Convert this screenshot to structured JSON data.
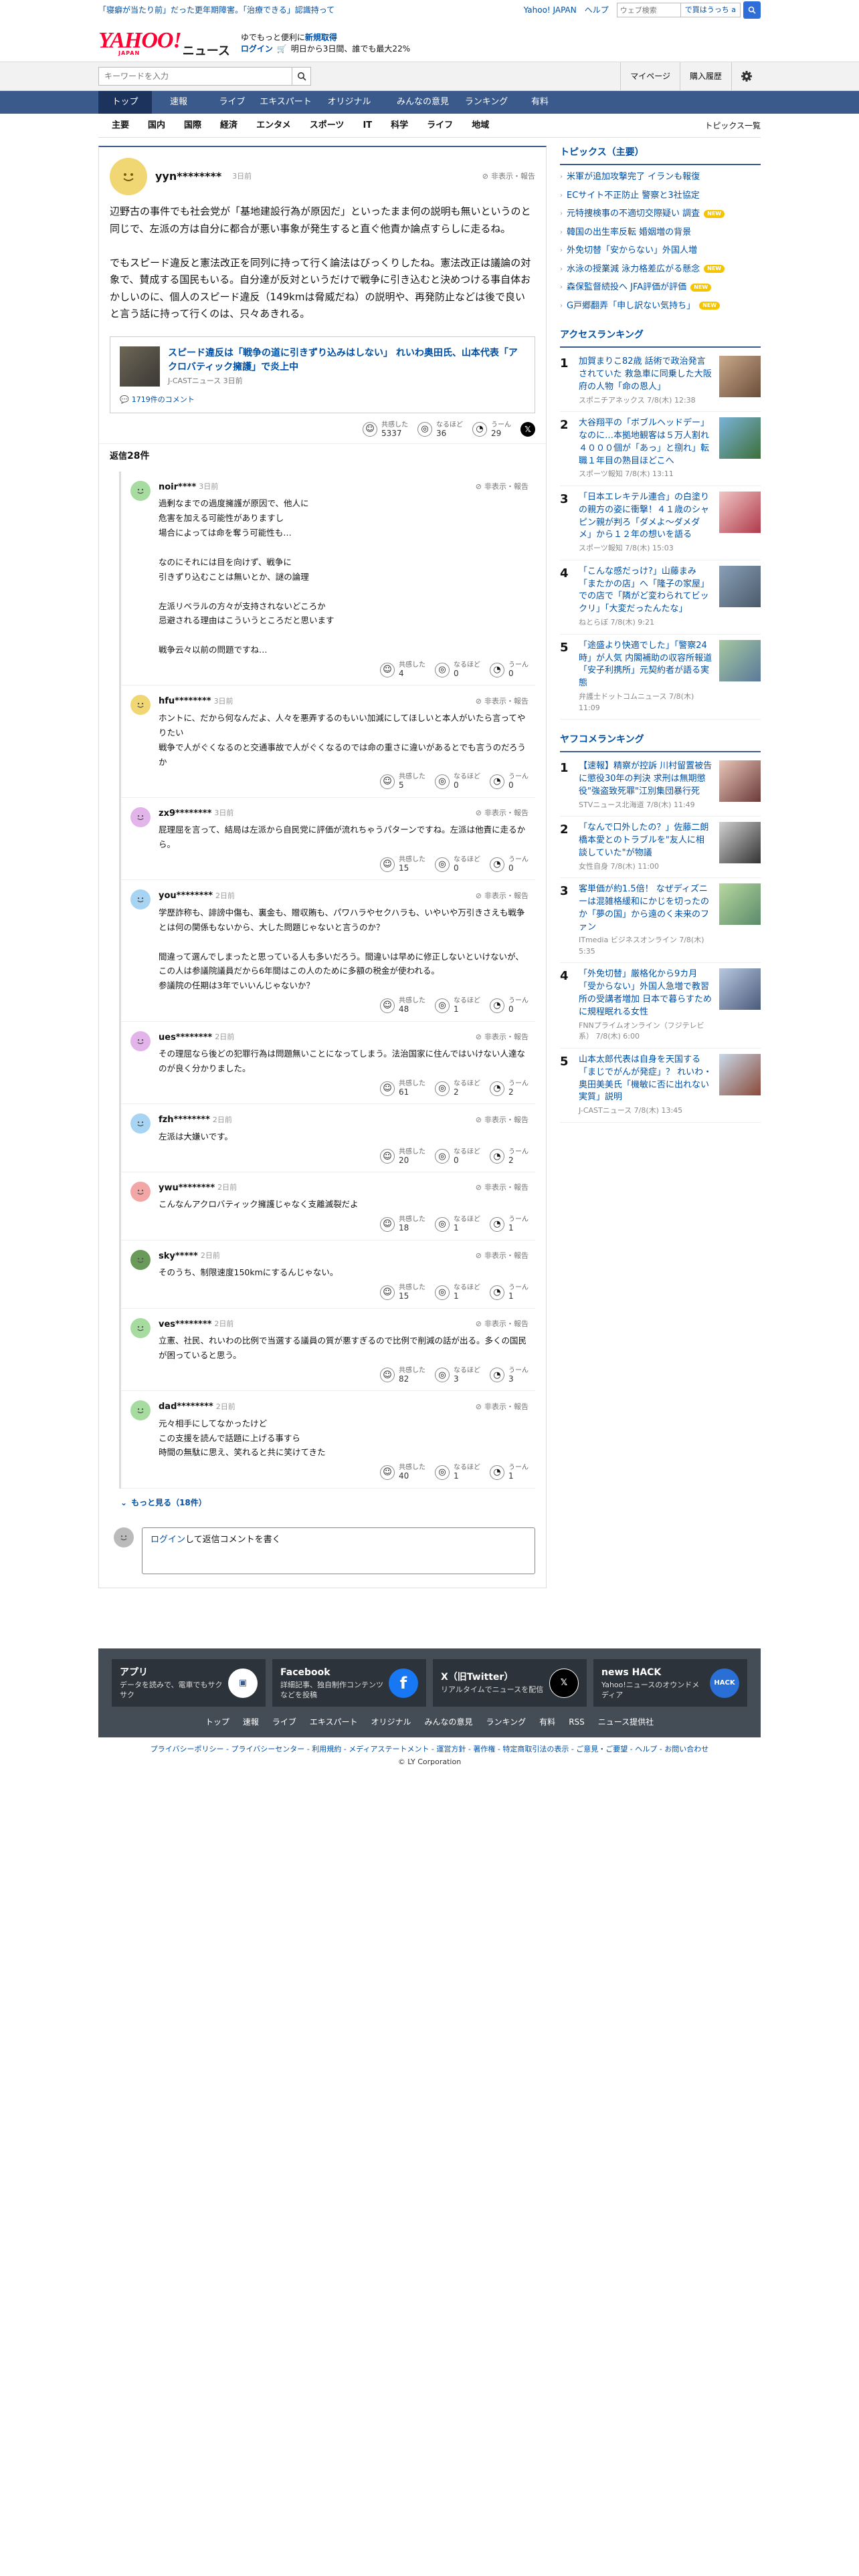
{
  "top": {
    "promo": "「寝癖が当たり前」だった更年期障害。「治療できる」認識持って",
    "links": [
      "Yahoo! JAPAN",
      "ヘルプ"
    ],
    "search_placeholder": "ウェブ検索",
    "search_btn": "で買はうっち a"
  },
  "header": {
    "logo_main": "YAHOO!",
    "logo_sub": "JAPAN",
    "logo_news": "ニュース",
    "msg_line1a": "ゆでもっと便利に",
    "msg_line1b": "新規取得",
    "msg_login": "ログイン",
    "msg_line2": "明日から3日間、誰でも最大22%"
  },
  "searchbar": {
    "placeholder": "キーワードを入力",
    "mypage": "マイページ",
    "history": "購入履歴"
  },
  "nav": [
    "トップ",
    "速報",
    "ライブ",
    "エキスパート",
    "オリジナル",
    "みんなの意見",
    "ランキング",
    "有料"
  ],
  "subnav": [
    "主要",
    "国内",
    "国際",
    "経済",
    "エンタメ",
    "スポーツ",
    "IT",
    "科学",
    "ライフ",
    "地域"
  ],
  "subnav_all": "トピックス一覧",
  "common": {
    "hide_report": "非表示・報告",
    "react_agree": "共感した",
    "react_think": "なるほど",
    "react_hmm": "うーん"
  },
  "post": {
    "user": "yyn********",
    "time": "3日前",
    "text": "辺野古の事件でも社会党が「基地建設行為が原因だ」といったまま何の説明も無いというのと同じで、左派の方は自分に都合が悪い事象が発生すると直ぐ他責か論点すらしに走るね。\n\nでもスピード違反と憲法改正を同列に持って行く論法はびっくりしたね。憲法改正は議論の対象で、賛成する国民もいる。自分達が反対というだけで戦争に引き込むと決めつける事自体おかしいのに、個人のスピード違反（149kmは脅威だね）の説明や、再発防止などは後で良いと言う話に持って行くのは、只々あきれる。",
    "article_title": "スピード違反は「戦争の道に引きずり込みはしない」 れいわ奥田氏、山本代表「アクロバティック擁護」で炎上中",
    "article_src": "J-CASTニュース 3日前",
    "article_comments": "1719件のコメント",
    "agree": "5337",
    "think": "36",
    "hmm": "29"
  },
  "reply_count_label": "返信",
  "reply_count": "28件",
  "replies": [
    {
      "user": "noir****",
      "time": "3日前",
      "text": "過剰なまでの過度擁護が原因で、他人に\n危害を加える可能性がありますし\n場合によっては命を奪う可能性も…\n\nなのにそれには目を向けず、戦争に\n引きずり込むことは無いとか、謎の論理\n\n左派リベラルの方々が支持されないどころか\n忌避される理由はこういうところだと思います\n\n戦争云々以前の問題ですね…",
      "agree": "4",
      "think": "0",
      "hmm": "0"
    },
    {
      "user": "hfu********",
      "time": "3日前",
      "text": "ホントに、だから何なんだよ、人々を悪弄するのもいい加減にしてほしいと本人がいたら言ってやりたい\n戦争で人がぐくなるのと交通事故で人がぐくなるのでは命の重さに違いがあるとでも言うのだろうか",
      "agree": "5",
      "think": "0",
      "hmm": "0"
    },
    {
      "user": "zx9********",
      "time": "3日前",
      "text": "屁理屈を言って、結局は左派から自民党に評価が流れちゃうパターンですね。左派は他責に走るから。",
      "agree": "15",
      "think": "0",
      "hmm": "0"
    },
    {
      "user": "you********",
      "time": "2日前",
      "text": "学歴詐称も、誹謗中傷も、裏金も、贈収賄も、パワハラやセクハラも、いやいや万引きさえも戦争とは何の関係もないから、大した問題じゃないと言うのか？\n\n間違って選んでしまったと思っている人も多いだろう。間違いは早めに修正しないといけないが、この人は参議院議員だから6年間はこの人のために多額の税金が使われる。\n参議院の任期は3年でいいんじゃないか？",
      "agree": "48",
      "think": "1",
      "hmm": "0"
    },
    {
      "user": "ues********",
      "time": "2日前",
      "text": "その理屈なら後どの犯罪行為は問題無いことになってしまう。法治国家に住んではいけない人達なのが良く分かりました。",
      "agree": "61",
      "think": "2",
      "hmm": "2"
    },
    {
      "user": "fzh********",
      "time": "2日前",
      "text": "左派は大嫌いです。",
      "agree": "20",
      "think": "0",
      "hmm": "2"
    },
    {
      "user": "ywu********",
      "time": "2日前",
      "text": "こんなんアクロバティック擁護じゃなく支離滅裂だよ",
      "agree": "18",
      "think": "1",
      "hmm": "1"
    },
    {
      "user": "sky*****",
      "time": "2日前",
      "text": "そのうち、制限速度150kmにするんじゃない。",
      "agree": "15",
      "think": "1",
      "hmm": "1"
    },
    {
      "user": "ves********",
      "time": "2日前",
      "text": "立憲、社民、れいわの比例で当選する議員の質が悪すぎるので比例で削減の話が出る。多くの国民が困っていると思う。",
      "agree": "82",
      "think": "3",
      "hmm": "3"
    },
    {
      "user": "dad********",
      "time": "2日前",
      "text": "元々相手にしてなかったけど\nこの支援を読んで話題に上げる事すら\n時間の無駄に思え、笑れると共に笑けてきた",
      "agree": "40",
      "think": "1",
      "hmm": "1"
    }
  ],
  "more_label": "もっと見る（18件）",
  "reply_form": {
    "login": "ログイン",
    "rest": "して返信コメントを書く"
  },
  "side": {
    "topics_title": "トピックス（主要）",
    "topics": [
      {
        "t": "米軍が追加攻撃完了 イランも報復",
        "nw": ""
      },
      {
        "t": "ECサイト不正防止 警察と3社協定",
        "nw": ""
      },
      {
        "t": "元特捜検事の不適切交際疑い 調査",
        "nw": "NEW"
      },
      {
        "t": "韓国の出生率反転 婚姻増の背景",
        "nw": ""
      },
      {
        "t": "外免切替「安からない」外国人増",
        "nw": ""
      },
      {
        "t": "水泳の授業減 泳力格差広がる懸念",
        "nw": "NEW"
      },
      {
        "t": "森保監督続投へ JFA評価が評価",
        "nw": "NEW"
      },
      {
        "t": "G戸郷翻弄「申し訳ない気持ち」",
        "nw": "NEW"
      }
    ],
    "access_title": "アクセスランキング",
    "access": [
      {
        "n": "1",
        "t": "加賀まりこ82歳 話術で政治発言されていた 救急車に同乗した大阪府の人物「命の恩人」",
        "s": "スポニチアネックス 7/8(木) 12:38"
      },
      {
        "n": "2",
        "t": "大谷翔平の「ボブルヘッドデー」なのに…本拠地観客は５万人割れ ４０００個が「あっ」と捌れ」転職１年目の熟目ほどこへ",
        "s": "スポーツ報知 7/8(木) 13:11"
      },
      {
        "n": "3",
        "t": "「日本エレキテル連合」の白塗りの親方の姿に衝撃！４１歳のシャピン親が判ろ「ダメよ〜ダメダメ」から１２年の想いを語る",
        "s": "スポーツ報知 7/8(木) 15:03"
      },
      {
        "n": "4",
        "t": "「こんな感だっけ?」山藤まみ「またかの店」へ「隆子の家屋」での店で「隣がど変わられてビックリ」「大変だったんたな」",
        "s": "ねとらぼ 7/8(木) 9:21"
      },
      {
        "n": "5",
        "t": "「途盛より快適でした」「警察24時」が人気 内閣補助の収容所報道「安子利携所」元契約者が語る実態",
        "s": "弁護士ドットコムニュース 7/8(木) 11:09"
      }
    ],
    "comment_title": "ヤフコメランキング",
    "comment": [
      {
        "n": "1",
        "t": "【速報】精察が控訴 川村留置被告に懲役30年の判決 求刑は無期懲役\"強盗致死罪\"江別集団暴行死",
        "s": "STVニュース北海道 7/8(木) 11:49"
      },
      {
        "n": "2",
        "t": "「なんで口外したの？」佐藤二朗 橋本愛とのトラブルを\"友人に相談していた\"が物議",
        "s": "女性自身 7/8(木) 11:00"
      },
      {
        "n": "3",
        "t": "客単価が約1.5倍！ なぜディズニーは混雑格緩和にかじを切ったのか「夢の国」から遠のく未来のファン",
        "s": "ITmedia ビジネスオンライン 7/8(木) 5:35"
      },
      {
        "n": "4",
        "t": "「外免切替」厳格化から9カ月「受からない」外国人急増で教習所の受講者増加 日本で暮らすために規程眠れる女性",
        "s": "FNNプライムオンライン（フジテレビ系） 7/8(木) 6:00"
      },
      {
        "n": "5",
        "t": "山本太郎代表は自身を天国する「まじでがんが発症」？ れいわ・奥田美美氏「機敏に否に出れない実質」説明",
        "s": "J-CASTニュース 7/8(木) 13:45"
      }
    ]
  },
  "footer": {
    "cards": [
      {
        "t": "アプリ",
        "d": "データを読みで、電車でもサクサク"
      },
      {
        "t": "Facebook",
        "d": "詳細記事、独自制作コンテンツなどを投稿"
      },
      {
        "t": "X（旧Twitter）",
        "d": "リアルタイムでニュースを配信"
      },
      {
        "t": "news HACK",
        "d": "Yahoo!ニュースのオウンドメディア"
      }
    ],
    "links": [
      "トップ",
      "速報",
      "ライブ",
      "エキスパート",
      "オリジナル",
      "みんなの意見",
      "ランキング",
      "有料",
      "RSS",
      "ニュース提供社"
    ],
    "policy": "プライバシーポリシー - プライバシーセンター - 利用規約 - メディアステートメント - 運営方針 - 著作権 - 特定商取引法の表示 - ご意見・ご要望 - ヘルプ - お問い合わせ",
    "copy": "© LY Corporation"
  }
}
